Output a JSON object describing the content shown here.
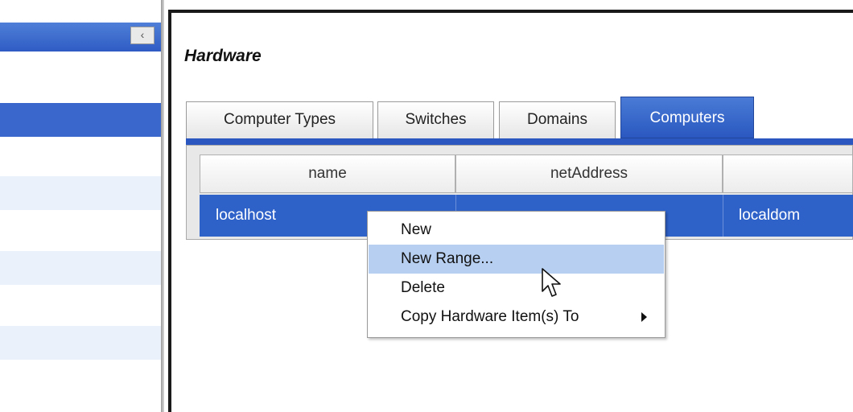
{
  "sidebar": {
    "collapse_glyph": "‹"
  },
  "panel": {
    "title": "Hardware"
  },
  "tabs": [
    {
      "label": "Computer Types",
      "active": false
    },
    {
      "label": "Switches",
      "active": false
    },
    {
      "label": "Domains",
      "active": false
    },
    {
      "label": "Computers",
      "active": true
    }
  ],
  "table": {
    "columns": [
      "name",
      "netAddress",
      ""
    ],
    "rows": [
      {
        "name": "localhost",
        "netAddress": "",
        "domain": "localdom",
        "selected": true
      }
    ]
  },
  "context_menu": {
    "items": [
      {
        "label": "New",
        "highlighted": false,
        "has_submenu": false
      },
      {
        "label": "New Range...",
        "highlighted": true,
        "has_submenu": false
      },
      {
        "label": "Delete",
        "highlighted": false,
        "has_submenu": false
      },
      {
        "label": "Copy Hardware Item(s) To",
        "highlighted": false,
        "has_submenu": true
      }
    ]
  },
  "colors": {
    "selection_blue": "#2f62c9",
    "menu_highlight": "#b7cff0",
    "alt_row": "#eaf1fb"
  }
}
